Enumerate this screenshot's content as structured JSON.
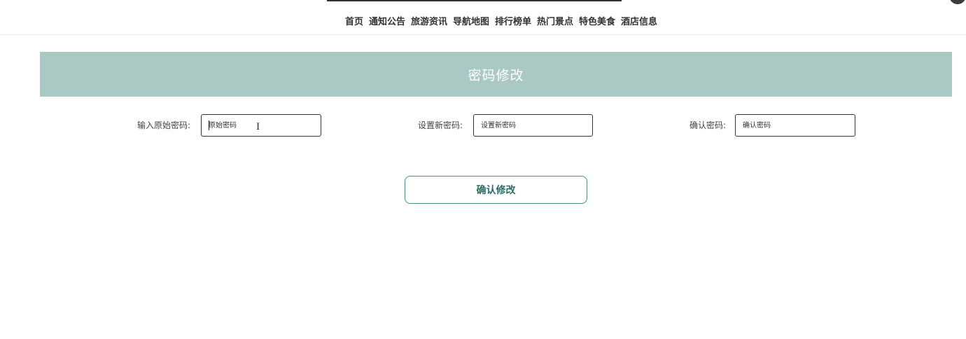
{
  "nav": {
    "items": [
      {
        "label": "首页"
      },
      {
        "label": "通知公告"
      },
      {
        "label": "旅游资讯"
      },
      {
        "label": "导航地图"
      },
      {
        "label": "排行榜单"
      },
      {
        "label": "热门景点"
      },
      {
        "label": "特色美食"
      },
      {
        "label": "酒店信息"
      }
    ]
  },
  "page": {
    "title": "密码修改"
  },
  "form": {
    "old_password": {
      "label": "输入原始密码:",
      "placeholder": "原始密码",
      "value": ""
    },
    "new_password": {
      "label": "设置新密码:",
      "placeholder": "设置新密码",
      "value": ""
    },
    "confirm_password": {
      "label": "确认密码:",
      "placeholder": "确认密码",
      "value": ""
    },
    "submit_label": "确认修改"
  },
  "icons": {
    "cursor": "text-cursor-icon",
    "corner": "user-avatar-icon"
  },
  "colors": {
    "banner": "#abc9c4",
    "accent": "#2c6e66"
  }
}
